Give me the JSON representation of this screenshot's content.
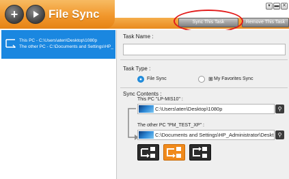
{
  "app": {
    "title": "File Sync"
  },
  "window_controls": {
    "minimize_glyph": "▾",
    "restore_glyph": "▬",
    "close_glyph": "✕"
  },
  "toolbar": {
    "sync_button_label": "Sync This Task",
    "remove_button_label": "Remove This Task"
  },
  "tasks": [
    {
      "line1": "This PC - C:\\Users\\aten\\Desktop\\1080p",
      "line2": "The other PC - C:\\Documents and Settings\\HP_",
      "selected": true
    }
  ],
  "form": {
    "task_name_label": "Task Name :",
    "task_name_value": "",
    "task_type_label": "Task Type :",
    "task_type_options": [
      {
        "label": "File Sync",
        "selected": true
      },
      {
        "label": "My Favorites Sync",
        "selected": false
      }
    ],
    "sync_contents_label": "Sync Contents :",
    "this_pc_label": "This PC \"LP-MIS10\" :",
    "this_pc_path": "C:\\Users\\aten\\Desktop\\1080p",
    "other_pc_label": "The other PC \"PM_TEST_XP\" :",
    "other_pc_path": "C:\\Documents and Settings\\HP_Administrator\\Deskt",
    "sync_direction": "two-way"
  },
  "icons": {
    "add": "plus-icon",
    "play": "play-icon",
    "search": "search-icon"
  },
  "colors": {
    "accent_orange": "#f08a1c",
    "selection_blue": "#1a87e0",
    "highlight_red": "#e21b1b"
  }
}
